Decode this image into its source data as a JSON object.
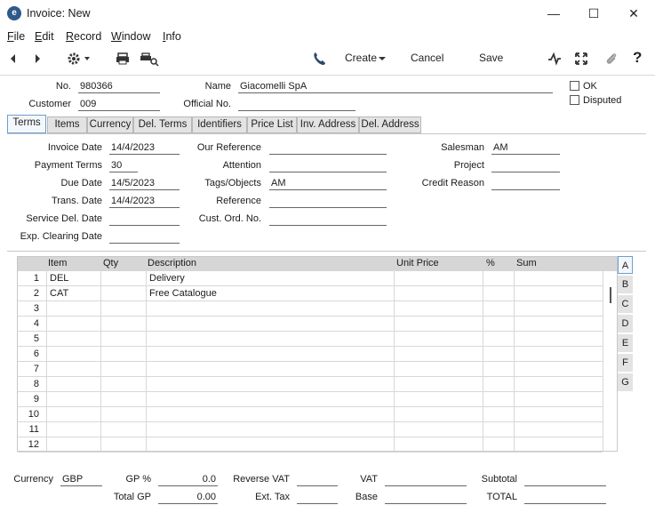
{
  "window": {
    "title": "Invoice: New",
    "minimize": "—",
    "maximize": "☐",
    "close": "✕"
  },
  "menu": [
    {
      "first": "F",
      "rest": "ile"
    },
    {
      "first": "E",
      "rest": "dit"
    },
    {
      "first": "R",
      "rest": "ecord"
    },
    {
      "first": "W",
      "rest": "indow"
    },
    {
      "first": "I",
      "rest": "nfo"
    }
  ],
  "toolbar": {
    "create": "Create",
    "cancel": "Cancel",
    "save": "Save",
    "help": "?"
  },
  "header": {
    "no_label": "No.",
    "no_value": "980366",
    "name_label": "Name",
    "name_value": "Giacomelli SpA",
    "customer_label": "Customer",
    "customer_value": "009",
    "official_label": "Official No.",
    "official_value": "",
    "ok_label": "OK",
    "disputed_label": "Disputed"
  },
  "tabs": [
    "Terms",
    "Items",
    "Currency",
    "Del. Terms",
    "Identifiers",
    "Price List",
    "Inv. Address",
    "Del. Address"
  ],
  "terms": {
    "invoice_date_label": "Invoice Date",
    "invoice_date": "14/4/2023",
    "payment_terms_label": "Payment Terms",
    "payment_terms": "30",
    "due_date_label": "Due Date",
    "due_date": "14/5/2023",
    "trans_date_label": "Trans. Date",
    "trans_date": "14/4/2023",
    "service_del_label": "Service Del. Date",
    "service_del": "",
    "exp_clearing_label": "Exp. Clearing Date",
    "exp_clearing": "",
    "our_ref_label": "Our Reference",
    "our_ref": "",
    "attention_label": "Attention",
    "attention": "",
    "tags_label": "Tags/Objects",
    "tags": "AM",
    "reference_label": "Reference",
    "reference": "",
    "cust_ord_label": "Cust. Ord. No.",
    "cust_ord": "",
    "salesman_label": "Salesman",
    "salesman": "AM",
    "project_label": "Project",
    "project": "",
    "credit_reason_label": "Credit Reason",
    "credit_reason": ""
  },
  "grid": {
    "columns": [
      "Item",
      "Qty",
      "Description",
      "Unit Price",
      "%",
      "Sum"
    ],
    "rows": [
      {
        "n": "1",
        "item": "DEL",
        "qty": "",
        "desc": "Delivery",
        "price": "",
        "pct": "",
        "sum": ""
      },
      {
        "n": "2",
        "item": "CAT",
        "qty": "",
        "desc": "Free Catalogue",
        "price": "",
        "pct": "",
        "sum": ""
      },
      {
        "n": "3",
        "item": "",
        "qty": "",
        "desc": "",
        "price": "",
        "pct": "",
        "sum": ""
      },
      {
        "n": "4",
        "item": "",
        "qty": "",
        "desc": "",
        "price": "",
        "pct": "",
        "sum": ""
      },
      {
        "n": "5",
        "item": "",
        "qty": "",
        "desc": "",
        "price": "",
        "pct": "",
        "sum": ""
      },
      {
        "n": "6",
        "item": "",
        "qty": "",
        "desc": "",
        "price": "",
        "pct": "",
        "sum": ""
      },
      {
        "n": "7",
        "item": "",
        "qty": "",
        "desc": "",
        "price": "",
        "pct": "",
        "sum": ""
      },
      {
        "n": "8",
        "item": "",
        "qty": "",
        "desc": "",
        "price": "",
        "pct": "",
        "sum": ""
      },
      {
        "n": "9",
        "item": "",
        "qty": "",
        "desc": "",
        "price": "",
        "pct": "",
        "sum": ""
      },
      {
        "n": "10",
        "item": "",
        "qty": "",
        "desc": "",
        "price": "",
        "pct": "",
        "sum": ""
      },
      {
        "n": "11",
        "item": "",
        "qty": "",
        "desc": "",
        "price": "",
        "pct": "",
        "sum": ""
      },
      {
        "n": "12",
        "item": "",
        "qty": "",
        "desc": "",
        "price": "",
        "pct": "",
        "sum": ""
      }
    ],
    "side_tabs": [
      "A",
      "B",
      "C",
      "D",
      "E",
      "F",
      "G"
    ]
  },
  "footer": {
    "currency_label": "Currency",
    "currency": "GBP",
    "gp_pct_label": "GP %",
    "gp_pct": "0.0",
    "total_gp_label": "Total GP",
    "total_gp": "0.00",
    "reverse_vat_label": "Reverse VAT",
    "reverse_vat": "",
    "ext_tax_label": "Ext. Tax",
    "ext_tax": "",
    "vat_label": "VAT",
    "vat": "",
    "base_label": "Base",
    "base": "",
    "subtotal_label": "Subtotal",
    "subtotal": "",
    "total_label": "TOTAL",
    "total": ""
  },
  "colors": {
    "accent": "#6c9ed0",
    "grid_header": "#d6d6d6",
    "tab_bg": "#e3e3e3"
  }
}
